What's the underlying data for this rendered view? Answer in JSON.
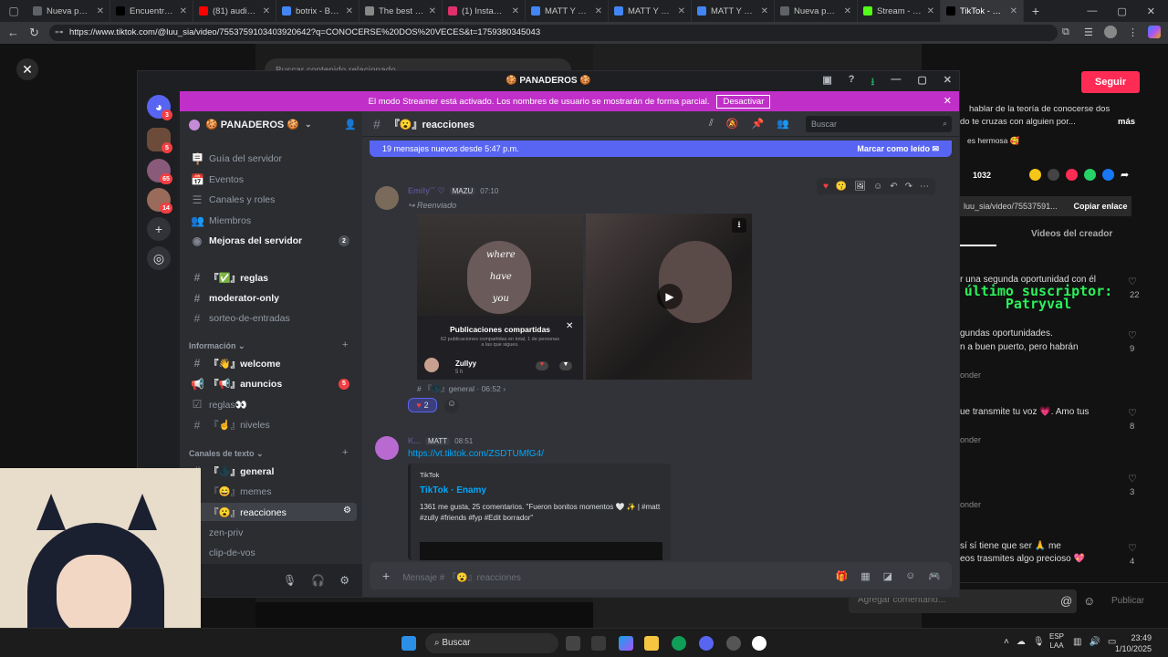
{
  "browser": {
    "tabs": [
      {
        "label": "Nueva pestaña",
        "color": "#5f6368"
      },
      {
        "label": "Encuentra 'CC",
        "color": "#000000"
      },
      {
        "label": "(81) audio FU",
        "color": "#ff0000"
      },
      {
        "label": "botrix - Búsqu",
        "color": "#4285f4"
      },
      {
        "label": "The best Chat",
        "color": "#888888"
      },
      {
        "label": "(1) Instagram",
        "color": "#e1306c"
      },
      {
        "label": "MATT Y ZULLY",
        "color": "#4285f4"
      },
      {
        "label": "MATT Y ZULLY",
        "color": "#4285f4"
      },
      {
        "label": "MATT Y ZULLY",
        "color": "#4285f4"
      },
      {
        "label": "Nueva pestaña",
        "color": "#5f6368"
      },
      {
        "label": "Stream - Kick",
        "color": "#53fc18"
      },
      {
        "label": "TikTok - Make",
        "color": "#000000"
      }
    ],
    "url": "https://www.tiktok.com/@luu_sia/video/7553759103403920642?q=CONOCERSE%20DOS%20VECES&t=1759380345043"
  },
  "tiktok": {
    "search_placeholder": "Buscar contenido relacionado",
    "follow_label": "Seguir",
    "comment1": "hablar de la teoría de conocerse dos",
    "comment1b": "do te cruzas con alguien por...",
    "more_label": "más",
    "comment1c": "es hermosa 🥰",
    "shares": "1032",
    "link_short": "luu_sia/video/75537591...",
    "copy_link": "Copiar enlace",
    "creator_videos": "Videos del creador",
    "c2a": "r una segunda oportunidad con él",
    "c2_likes": "22",
    "c3a": "gundas oportunidades.",
    "c3b": "n a buen puerto, pero habrán",
    "c3_likes": "9",
    "reply1": "onder",
    "c4a": "ue transmite tu voz 💗. Amo tus",
    "c4_likes": "8",
    "reply2": "onder",
    "c5_likes": "3",
    "reply3": "onder",
    "c6a": "sí sí tiene que ser 🙏 me",
    "c6b": "eos trasmites algo precioso 💖",
    "c6_likes": "4",
    "comment_placeholder": "Agregar comentario...",
    "publish": "Publicar"
  },
  "overlay": {
    "line1": "último suscriptor:",
    "line2": "Patryval"
  },
  "discord": {
    "window_title": "🍪 PANADEROS 🍪",
    "banner_text": "El modo Streamer está activado. Los nombres de usuario se mostrarán de forma parcial.",
    "banner_button": "Desactivar",
    "server_name": "🍪 PANADEROS 🍪",
    "rail_badges": [
      "3",
      "5",
      "65",
      "14"
    ],
    "top_items": [
      {
        "icon": "🪧",
        "label": "Guía del servidor"
      },
      {
        "icon": "📅",
        "label": "Eventos"
      },
      {
        "icon": "☰",
        "label": "Canales y roles"
      },
      {
        "icon": "👥",
        "label": "Miembros"
      },
      {
        "icon": "◉",
        "label": "Mejoras del servidor",
        "badge": "2"
      }
    ],
    "channels_a": [
      {
        "label": "『✅』reglas",
        "bold": true
      },
      {
        "label": "moderator-only",
        "bold": true
      },
      {
        "label": "sorteo-de-entradas",
        "bold": false
      }
    ],
    "cat_info": "Información",
    "channels_b": [
      {
        "icon": "#",
        "label": "『👋』welcome",
        "bold": true
      },
      {
        "icon": "📢",
        "label": "『📢』anuncios",
        "bold": true,
        "badge": "5"
      },
      {
        "icon": "☑",
        "label": "reglas👀",
        "bold": false
      },
      {
        "icon": "#",
        "label": "『☝』niveles",
        "bold": false
      }
    ],
    "cat_text": "Canales de texto",
    "channels_c": [
      {
        "label": "『🌑』general",
        "bold": true
      },
      {
        "label": "『😄』memes",
        "bold": false
      },
      {
        "label": "『😮』reacciones",
        "bold": false,
        "active": true
      },
      {
        "label": "zen-priv",
        "bold": false
      },
      {
        "label": "clip-de-vos",
        "bold": false
      }
    ],
    "channel_title": "『😮』reacciones",
    "search": "Buscar",
    "new_messages": "19 mensajes nuevos desde 5:47 p.m.",
    "mark_read": "Marcar como leído",
    "msg1": {
      "author": "Emily˘˘ ♡",
      "role": "MAZU",
      "time": "07:10",
      "forwarded": "Reenviado",
      "shared_title": "Publicaciones compartidas",
      "shared_sub": "62 publicaciones compartidas en total, 1 de personas a las que sigues.",
      "shared_user": "Zullyy",
      "shared_time": "5 h",
      "video_text": [
        "where",
        "have",
        "you"
      ],
      "source": "# 『🌑』general · 06:52 ›",
      "reaction_count": "2"
    },
    "msg2": {
      "author": "K...",
      "role": "MATT",
      "time": "08:51",
      "link": "https://vt.tiktok.com/ZSDTUMfG4/",
      "embed_site": "TikTok",
      "embed_title": "TikTok · Enamy",
      "embed_desc": "1361 me gusta, 25 comentarios. \"Fueron bonitos momentos 🤍 ✨ | #matt #zully #friends #fyp #Edit borrador\""
    },
    "composer_placeholder": "Mensaje # 『😮』reacciones"
  },
  "taskbar": {
    "search": "Buscar",
    "lang1": "ESP",
    "lang2": "LAA",
    "time": "23:49",
    "date": "1/10/2025"
  }
}
